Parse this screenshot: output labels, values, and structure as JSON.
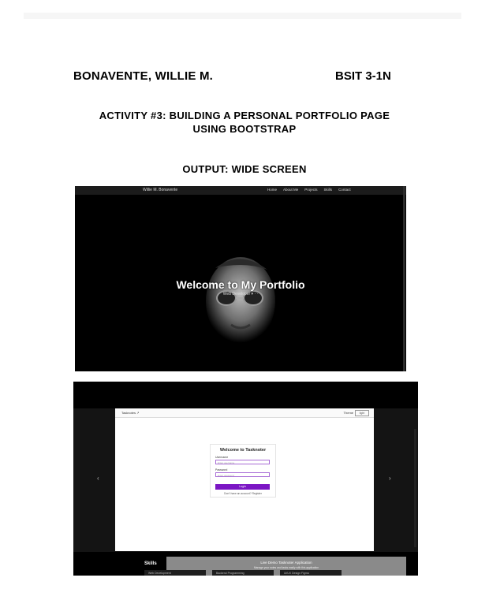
{
  "header": {
    "name": "BONAVENTE, WILLIE M.",
    "section": "BSIT 3-1N",
    "title_line1": "ACTIVITY #3: BUILDING A PERSONAL PORTFOLIO PAGE",
    "title_line2": "USING BOOTSTRAP",
    "output_label": "OUTPUT: WIDE SCREEN"
  },
  "screenshot1": {
    "brand": "Willie M. Bonavente",
    "nav": [
      "Home",
      "About Me",
      "Projects",
      "Skills",
      "Contact"
    ],
    "hero_title": "Welcome to My Portfolio",
    "hero_subtitle": "Web Developer ▾ · ·"
  },
  "screenshot2": {
    "bar_left": "Tasknotes ↗",
    "bar_right": "Theme",
    "bar_select": "light",
    "login_title": "Welcome to Tasknoter",
    "username_label": "Username",
    "username_placeholder": "Enter username",
    "password_label": "Password",
    "password_placeholder": "Enter password",
    "login_button": "Login",
    "register_link": "Don't have an account? Register",
    "banner_title": "Live Demo Tasknoter Application",
    "banner_sub": "Manage your notes and tasks easily with this application",
    "skills_heading": "Skills",
    "cards": [
      "Web Development",
      "Backend Programming",
      "Ui/UX Design Figma"
    ],
    "left_arrow": "‹",
    "right_arrow": "›"
  }
}
